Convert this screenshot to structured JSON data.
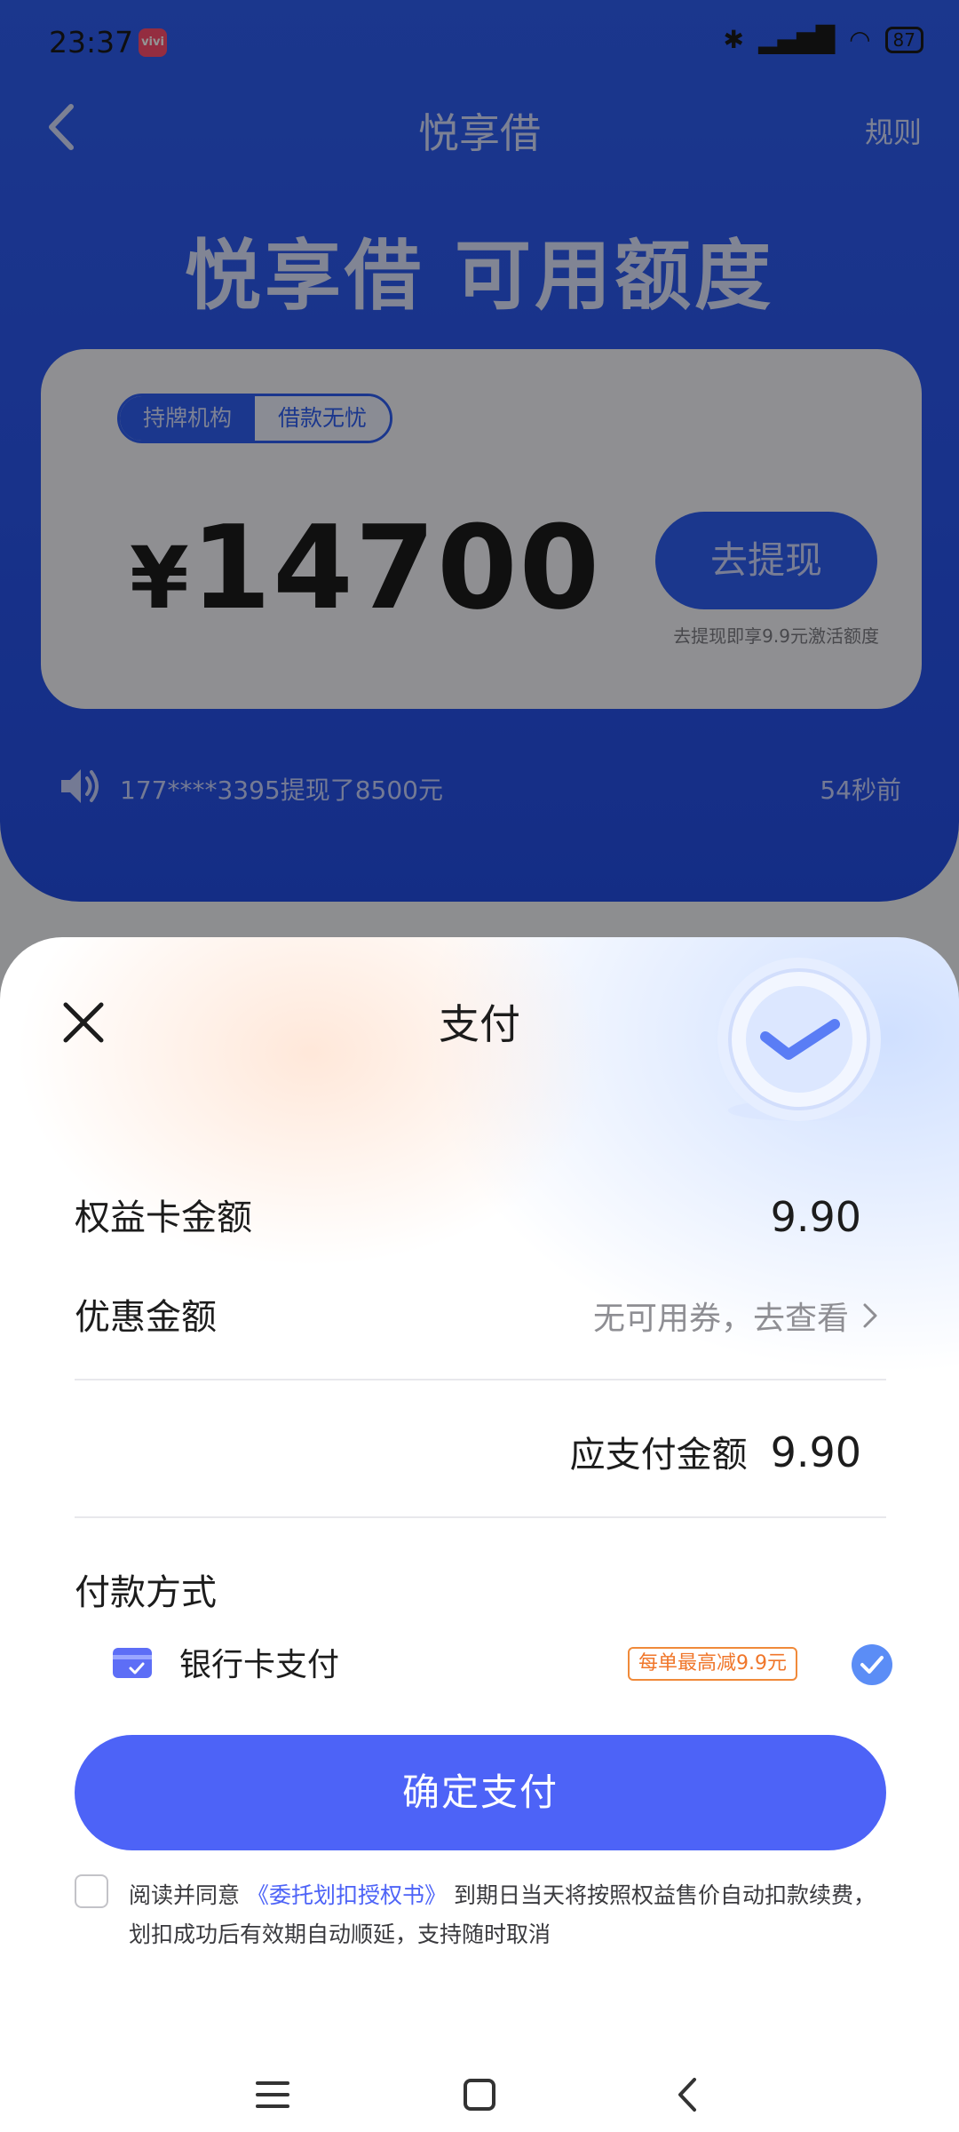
{
  "status_bar": {
    "time": "23:37",
    "app_badge": "vivi",
    "battery": "87"
  },
  "background_page": {
    "nav": {
      "title": "悦享借",
      "rule_link": "规则"
    },
    "hero_title": "悦享借 可用额度",
    "card": {
      "tags": [
        "持牌机构",
        "借款无忧"
      ],
      "currency_symbol": "¥",
      "amount": "14700",
      "withdraw_button": "去提现",
      "withdraw_tip": "去提现即享9.9元激活额度"
    },
    "ticker": {
      "text": "177****3395提现了8500元",
      "time": "54秒前"
    }
  },
  "sheet": {
    "title": "支付",
    "rows": {
      "card_amount_label": "权益卡金额",
      "card_amount_value": "9.90",
      "discount_label": "优惠金额",
      "discount_value": "无可用券，去查看",
      "due_label": "应支付金额",
      "due_value": "9.90"
    },
    "payment": {
      "title": "付款方式",
      "method": "银行卡支付",
      "promo_badge": "每单最高减9.9元",
      "selected": true
    },
    "confirm_button": "确定支付",
    "agreement": {
      "prefix": "阅读并同意",
      "link": "《委托划扣授权书》",
      "suffix": "到期日当天将按照权益售价自动扣款续费，划扣成功后有效期自动顺延，支持随时取消"
    }
  },
  "colors": {
    "brand_blue": "#2f5ff3",
    "button_blue": "#4d63f7",
    "promo_orange": "#f0762a"
  },
  "icons": [
    "back-arrow-icon",
    "speaker-icon",
    "close-icon",
    "check-coin-icon",
    "bank-card-icon",
    "selected-check-icon",
    "menu-icon",
    "home-icon",
    "back-icon"
  ]
}
